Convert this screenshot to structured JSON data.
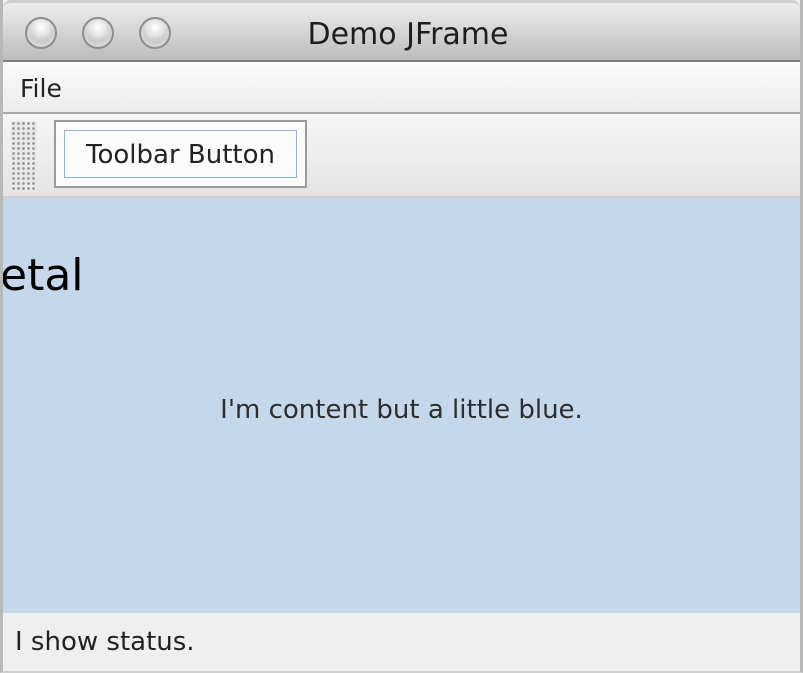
{
  "window": {
    "title": "Demo JFrame",
    "controls": [
      "close-button-icon",
      "minimize-button-icon",
      "zoom-button-icon"
    ]
  },
  "menubar": {
    "items": [
      {
        "label": "File"
      }
    ]
  },
  "toolbar": {
    "button_label": "Toolbar Button"
  },
  "content": {
    "partial_label": "etal",
    "message": "I'm content but a little blue.",
    "background_color": "#c5d7eb"
  },
  "statusbar": {
    "text": "I show status."
  }
}
